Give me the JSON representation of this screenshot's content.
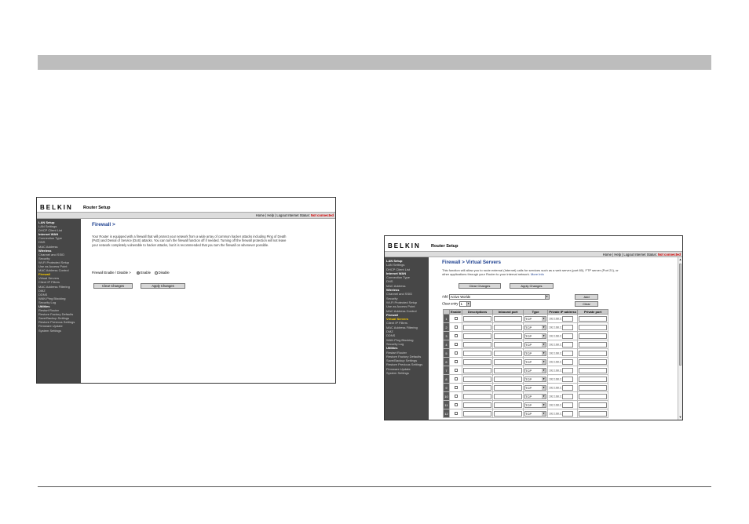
{
  "firewall_screenshot": {
    "brand": "BELKIN",
    "app_title": "Router Setup",
    "header_links": "Home | Help | Logout  Internet Status:",
    "internet_status": "Not connected",
    "sidebar": [
      {
        "label": "LAN Setup",
        "kind": "head"
      },
      {
        "label": "LAN Settings",
        "kind": "item"
      },
      {
        "label": "DHCP Client List",
        "kind": "item"
      },
      {
        "label": "Internet WAN",
        "kind": "head"
      },
      {
        "label": "Connection Type",
        "kind": "item"
      },
      {
        "label": "DNS",
        "kind": "item"
      },
      {
        "label": "MAC Address",
        "kind": "item"
      },
      {
        "label": "Wireless",
        "kind": "head"
      },
      {
        "label": "Channel and SSID",
        "kind": "item"
      },
      {
        "label": "Security",
        "kind": "item"
      },
      {
        "label": "Wi-Fi Protected Setup",
        "kind": "item"
      },
      {
        "label": "Use as Access Point",
        "kind": "item"
      },
      {
        "label": "MAC Address Control",
        "kind": "item"
      },
      {
        "label": "Firewall",
        "kind": "active"
      },
      {
        "label": "Virtual Servers",
        "kind": "item"
      },
      {
        "label": "Client IP Filters",
        "kind": "item"
      },
      {
        "label": "MAC Address Filtering",
        "kind": "item"
      },
      {
        "label": "DMZ",
        "kind": "item"
      },
      {
        "label": "DDNS",
        "kind": "item"
      },
      {
        "label": "WAN Ping Blocking",
        "kind": "item"
      },
      {
        "label": "Security Log",
        "kind": "item"
      },
      {
        "label": "Utilities",
        "kind": "head"
      },
      {
        "label": "Restart Router",
        "kind": "item"
      },
      {
        "label": "Restore Factory Defaults",
        "kind": "item"
      },
      {
        "label": "Save/Backup Settings",
        "kind": "item"
      },
      {
        "label": "Restore Previous Settings",
        "kind": "item"
      },
      {
        "label": "Firmware Update",
        "kind": "item"
      },
      {
        "label": "System Settings",
        "kind": "item"
      }
    ],
    "heading": "Firewall >",
    "description": "Your Router is equipped with a firewall that will protect your network from a wide array of common hacker attacks including Ping of Death (PoD) and Denial of Service (DoS) attacks. You can turn the firewall function off if needed. Turning off the firewall protection will not leave your network completely vulnerable to hacker attacks, but it is recommended that you turn the firewall on whenever possible.",
    "enable_label": "Firewall Enable / Disable >",
    "enable_option": "Enable",
    "disable_option": "Disable",
    "clear_button": "Clear Changes",
    "apply_button": "Apply Changes"
  },
  "virtual_servers_screenshot": {
    "brand": "BELKIN",
    "app_title": "Router Setup",
    "header_links": "Home | Help | Logout  Internet Status:",
    "internet_status": "Not connected",
    "sidebar": [
      {
        "label": "LAN Setup",
        "kind": "head"
      },
      {
        "label": "LAN Settings",
        "kind": "item"
      },
      {
        "label": "DHCP Client List",
        "kind": "item"
      },
      {
        "label": "Internet WAN",
        "kind": "head"
      },
      {
        "label": "Connection Type",
        "kind": "item"
      },
      {
        "label": "DNS",
        "kind": "item"
      },
      {
        "label": "MAC Address",
        "kind": "item"
      },
      {
        "label": "Wireless",
        "kind": "head"
      },
      {
        "label": "Channel and SSID",
        "kind": "item"
      },
      {
        "label": "Security",
        "kind": "item"
      },
      {
        "label": "Wi-Fi Protected Setup",
        "kind": "item"
      },
      {
        "label": "Use as Access Point",
        "kind": "item"
      },
      {
        "label": "MAC Address Control",
        "kind": "item"
      },
      {
        "label": "Firewall",
        "kind": "head"
      },
      {
        "label": "Virtual Servers",
        "kind": "active"
      },
      {
        "label": "Client IP Filters",
        "kind": "item"
      },
      {
        "label": "MAC Address Filtering",
        "kind": "item"
      },
      {
        "label": "DMZ",
        "kind": "item"
      },
      {
        "label": "DDNS",
        "kind": "item"
      },
      {
        "label": "WAN Ping Blocking",
        "kind": "item"
      },
      {
        "label": "Security Log",
        "kind": "item"
      },
      {
        "label": "Utilities",
        "kind": "head"
      },
      {
        "label": "Restart Router",
        "kind": "item"
      },
      {
        "label": "Restore Factory Defaults",
        "kind": "item"
      },
      {
        "label": "Save/Backup Settings",
        "kind": "item"
      },
      {
        "label": "Restore Previous Settings",
        "kind": "item"
      },
      {
        "label": "Firmware Update",
        "kind": "item"
      },
      {
        "label": "System Settings",
        "kind": "item"
      }
    ],
    "heading": "Firewall > Virtual Servers",
    "description": "This function will allow you to route external (Internet) calls for services such as a web server (port 80), FTP server (Port 21), or other applications through your Router to your internal network.",
    "more_info": "More Info",
    "clear_button": "Clear Changes",
    "apply_button": "Apply Changes",
    "add_label": "Add",
    "add_select_value": "Active Worlds",
    "add_button": "Add",
    "clear_entry_label": "Clear entry",
    "clear_entry_value": "1",
    "clear_button_small": "Clear",
    "table_headers": [
      "",
      "Enable",
      "Descriptions",
      "Inbound port",
      "Type",
      "Private IP address",
      "Private port"
    ],
    "row_numbers": [
      "1",
      "2",
      "3",
      "4",
      "5",
      "6",
      "7",
      "8",
      "9",
      "10",
      "11",
      "12"
    ],
    "type_value": "TCP",
    "ip_prefix": "192.168.2."
  }
}
